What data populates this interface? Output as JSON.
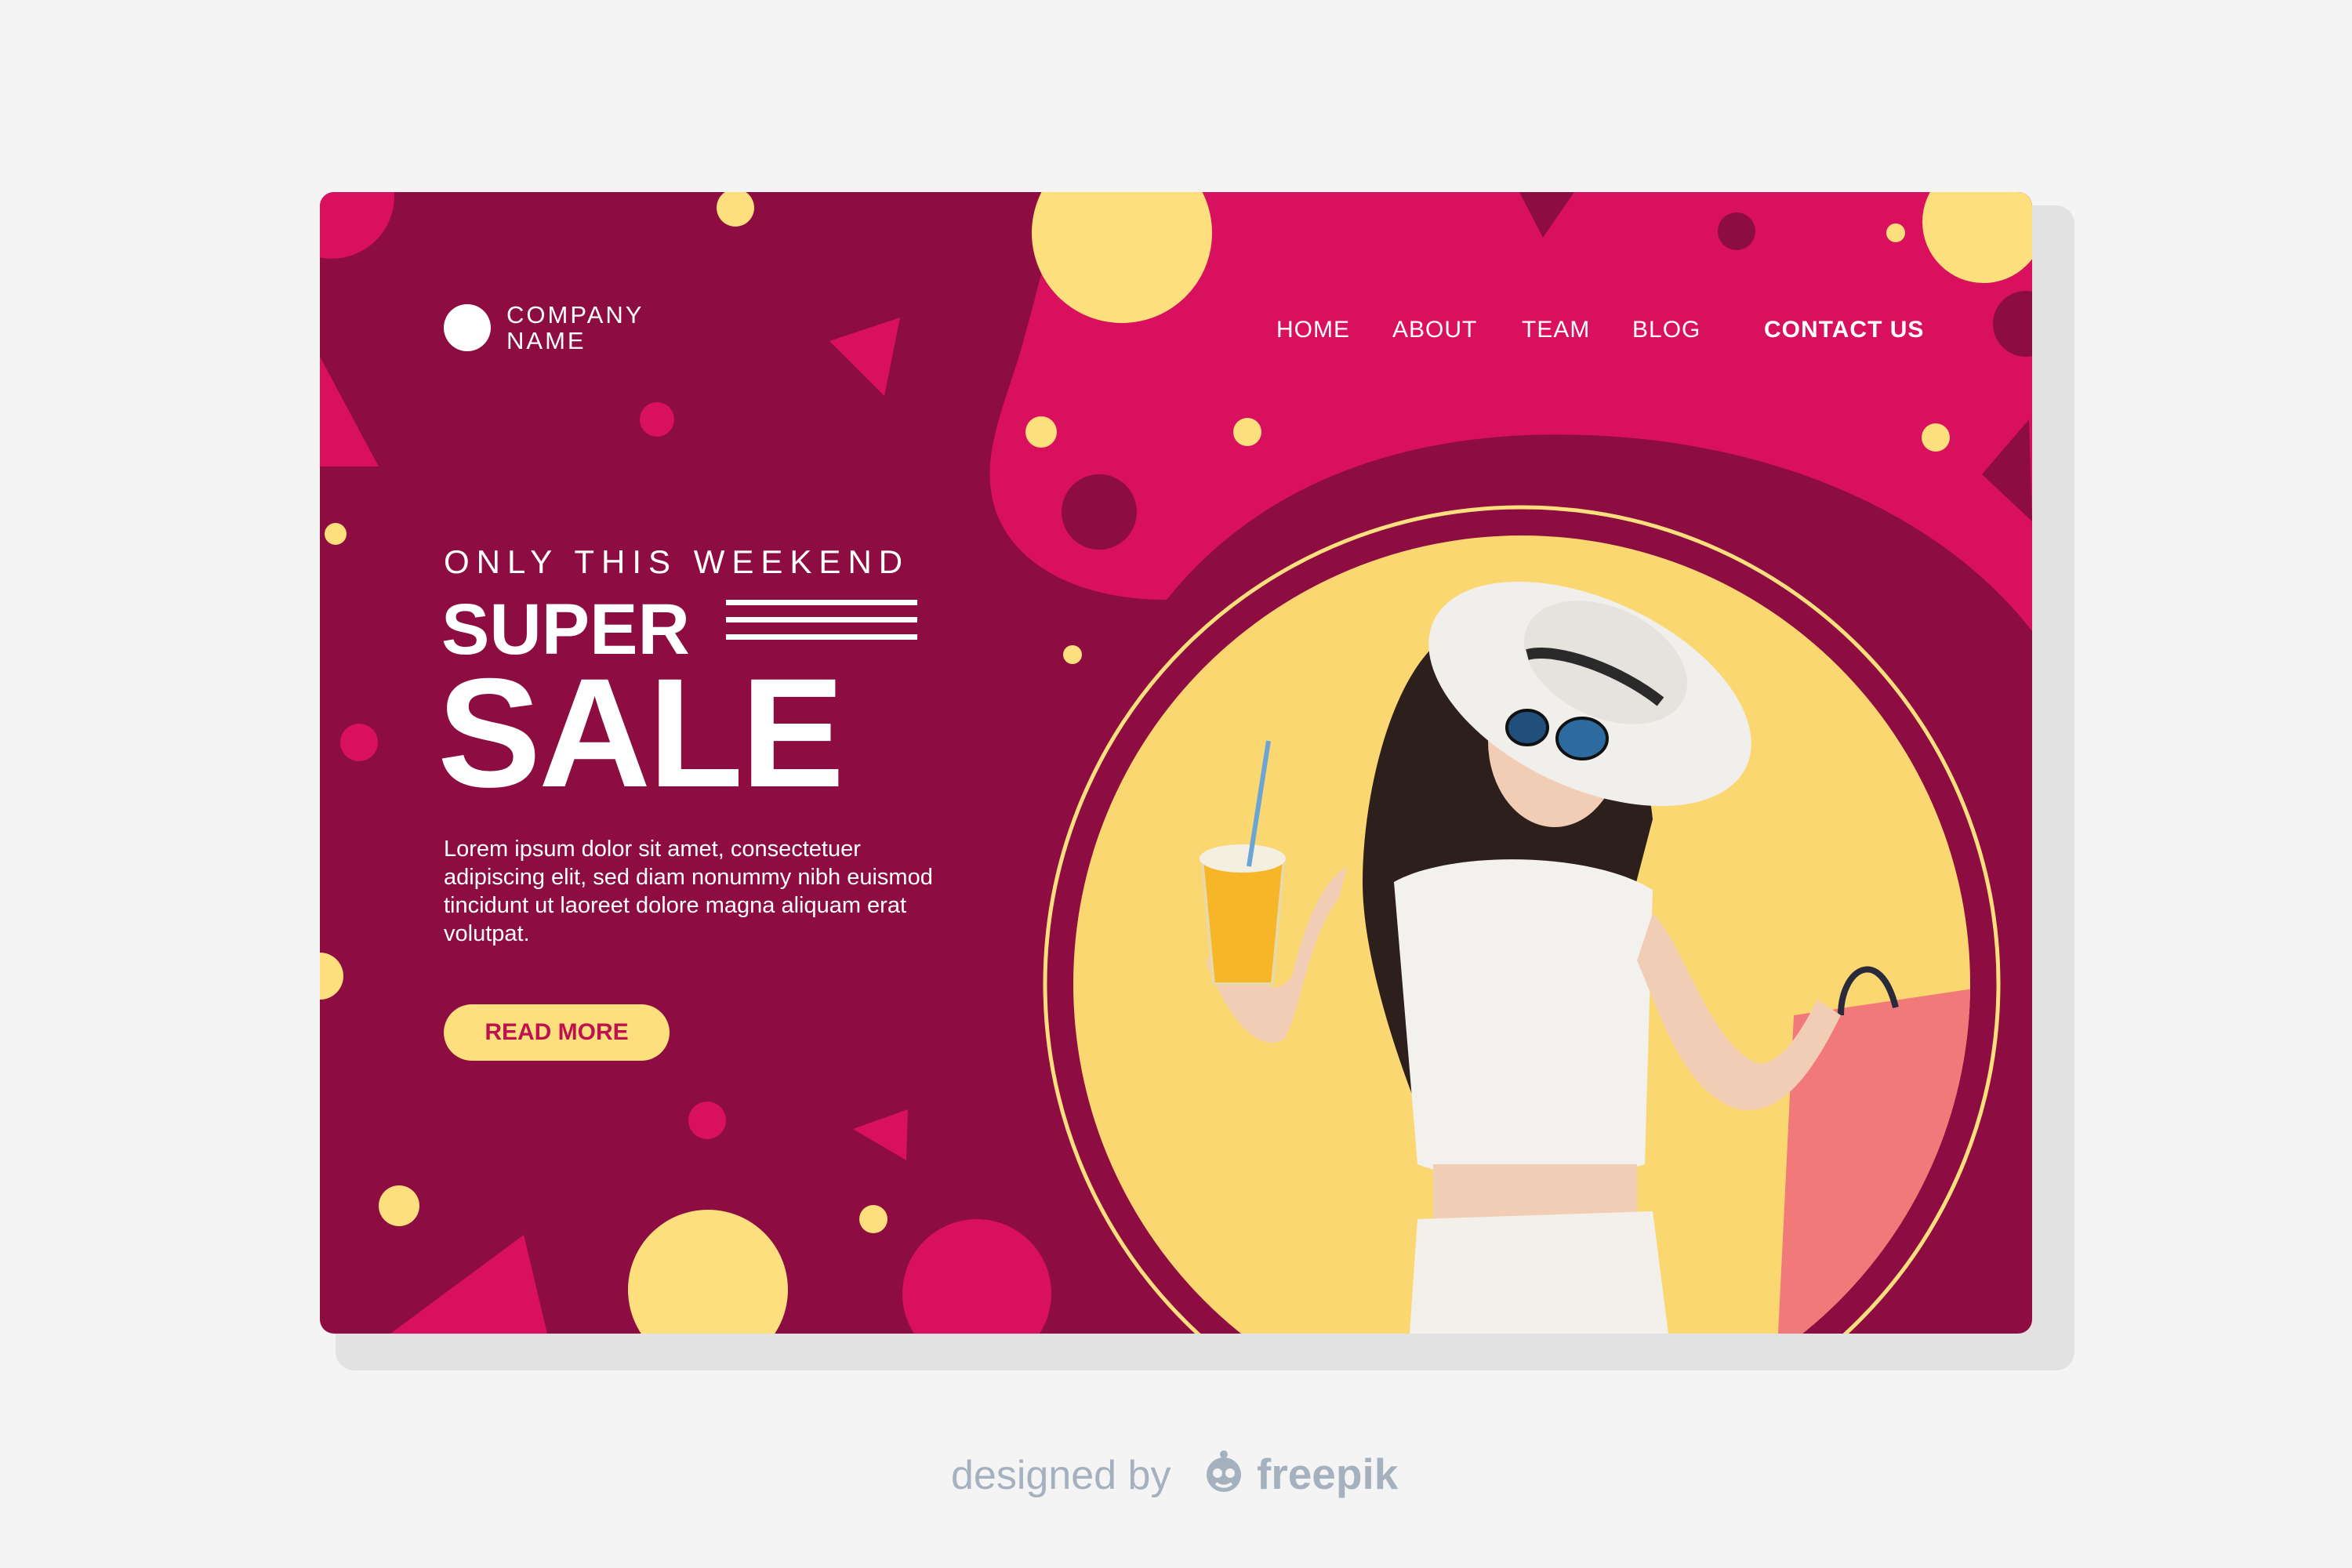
{
  "brand": {
    "logo_line1": "COMPANY",
    "logo_line2": "NAME"
  },
  "nav": {
    "items": [
      {
        "label": "HOME"
      },
      {
        "label": "ABOUT"
      },
      {
        "label": "TEAM"
      },
      {
        "label": "BLOG"
      }
    ],
    "cta_label": "CONTACT US"
  },
  "hero": {
    "eyebrow": "ONLY THIS WEEKEND",
    "title_line1": "SUPER",
    "title_line2": "SALE",
    "body": "Lorem ipsum dolor sit amet, consectetuer adipiscing elit, sed diam nonummy nibh euismod tincidunt ut laoreet dolore magna aliquam erat volutpat.",
    "button_label": "READ MORE"
  },
  "attribution": {
    "text": "designed by",
    "brand": "freepik",
    "icon": "freepik-mascot-icon"
  },
  "colors": {
    "background": "#f4f4f4",
    "panel": "#8d0c42",
    "accent_pink": "#e0105f",
    "accent_yellow": "#fde07d",
    "button_text": "#c0114f",
    "attribution": "#a5b1be"
  }
}
